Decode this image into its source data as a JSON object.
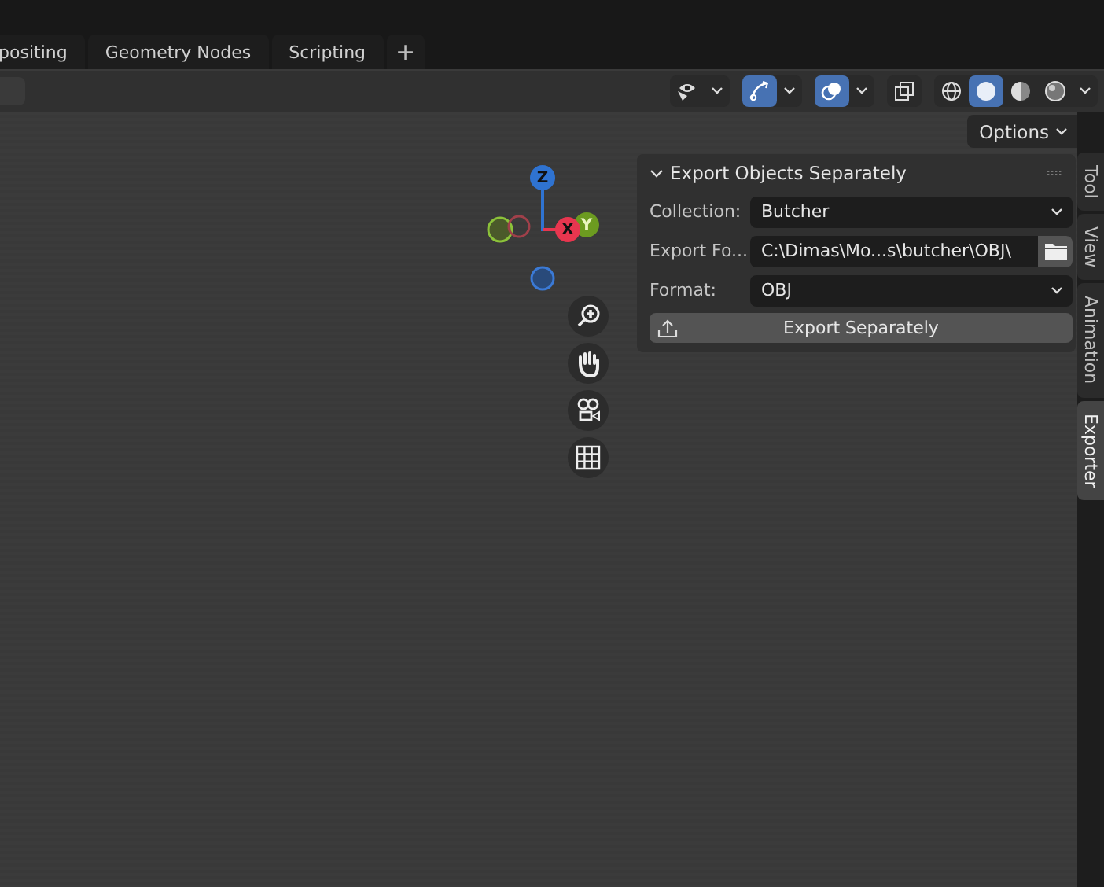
{
  "workspace_tabs": [
    {
      "label": "positing",
      "selected": false
    },
    {
      "label": "Geometry Nodes",
      "selected": false
    },
    {
      "label": "Scripting",
      "selected": false
    }
  ],
  "add_tab": "+",
  "header": {
    "shading_modes": [
      {
        "kind": "wireframe",
        "selected": false
      },
      {
        "kind": "solid",
        "selected": true
      },
      {
        "kind": "material",
        "selected": false
      },
      {
        "kind": "rendered",
        "selected": false
      }
    ],
    "gizmo_toggle": {
      "on": true
    },
    "overlay_toggle": {
      "on": true
    },
    "xray_toggle": {
      "on": false
    }
  },
  "options_button": "Options",
  "gizmo": {
    "axes": [
      {
        "label": "Z",
        "color": "#2f73d1"
      },
      {
        "label": "X",
        "color": "#e8364f"
      },
      {
        "label": "Y",
        "color": "#6c9b20"
      }
    ]
  },
  "panel": {
    "title": "Export Objects Separately",
    "expanded": true,
    "fields": [
      {
        "label": "Collection:",
        "value": "Butcher",
        "kind": "dropdown"
      },
      {
        "label": "Export Fo...",
        "value": "C:\\Dimas\\Mo...s\\butcher\\OBJ\\",
        "kind": "path"
      },
      {
        "label": "Format:",
        "value": "OBJ",
        "kind": "dropdown"
      }
    ],
    "button": "Export Separately"
  },
  "side_tabs": [
    {
      "label": "Tool",
      "selected": false
    },
    {
      "label": "View",
      "selected": false
    },
    {
      "label": "Animation",
      "selected": false
    },
    {
      "label": "Exporter",
      "selected": true
    }
  ]
}
